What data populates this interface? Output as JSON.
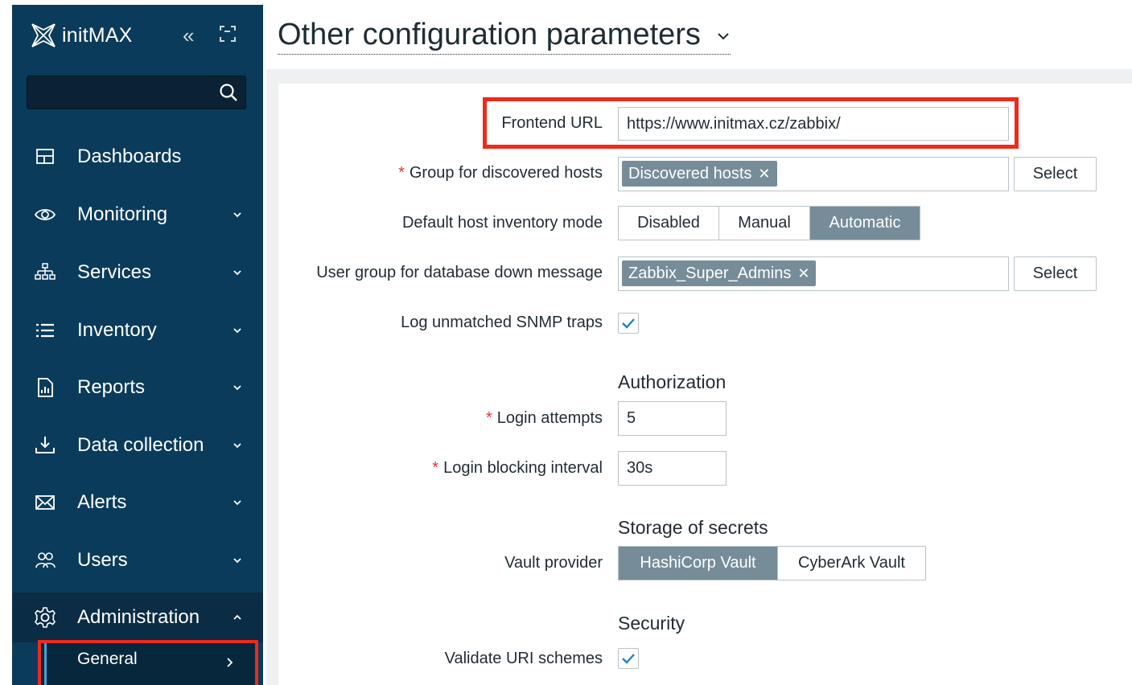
{
  "app": {
    "brand": "initMAX",
    "collapse_glyph": "«",
    "colors": {
      "sidebar": "#0b3b5a",
      "accent_red": "#f0291d",
      "tag_bg": "#768d99",
      "required": "#e3323c"
    }
  },
  "sidebar": {
    "search": {
      "value": "",
      "placeholder": ""
    },
    "items": [
      {
        "label": "Dashboards",
        "icon": "dashboard-icon",
        "chevron": ""
      },
      {
        "label": "Monitoring",
        "icon": "eye-icon",
        "chevron": "down"
      },
      {
        "label": "Services",
        "icon": "hierarchy-icon",
        "chevron": "down"
      },
      {
        "label": "Inventory",
        "icon": "list-icon",
        "chevron": "down"
      },
      {
        "label": "Reports",
        "icon": "report-icon",
        "chevron": "down"
      },
      {
        "label": "Data collection",
        "icon": "download-icon",
        "chevron": "down"
      },
      {
        "label": "Alerts",
        "icon": "envelope-icon",
        "chevron": "down"
      },
      {
        "label": "Users",
        "icon": "users-icon",
        "chevron": "down"
      },
      {
        "label": "Administration",
        "icon": "gear-icon",
        "chevron": "up"
      }
    ],
    "sub_item": {
      "label": "General"
    }
  },
  "page": {
    "title": "Other configuration parameters"
  },
  "form": {
    "frontend_url": {
      "label": "Frontend URL",
      "value": "https://www.initmax.cz/zabbix/"
    },
    "group_discovered": {
      "label": "Group for discovered hosts",
      "tag": "Discovered hosts",
      "tag_remove": "✕",
      "button": "Select"
    },
    "inventory_mode": {
      "label": "Default host inventory mode",
      "options": [
        "Disabled",
        "Manual",
        "Automatic"
      ],
      "selected": "Automatic"
    },
    "db_down_group": {
      "label": "User group for database down message",
      "tag": "Zabbix_Super_Admins",
      "tag_remove": "✕",
      "button": "Select"
    },
    "log_snmp": {
      "label": "Log unmatched SNMP traps",
      "checked": true
    },
    "authorization": {
      "heading": "Authorization",
      "login_attempts": {
        "label": "Login attempts",
        "value": "5"
      },
      "login_blocking": {
        "label": "Login blocking interval",
        "value": "30s"
      }
    },
    "storage": {
      "heading": "Storage of secrets",
      "vault_provider": {
        "label": "Vault provider",
        "options": [
          "HashiCorp Vault",
          "CyberArk Vault"
        ],
        "selected": "HashiCorp Vault"
      }
    },
    "security": {
      "heading": "Security",
      "validate_uri": {
        "label": "Validate URI schemes",
        "checked": true
      }
    },
    "required_mark": "*"
  }
}
